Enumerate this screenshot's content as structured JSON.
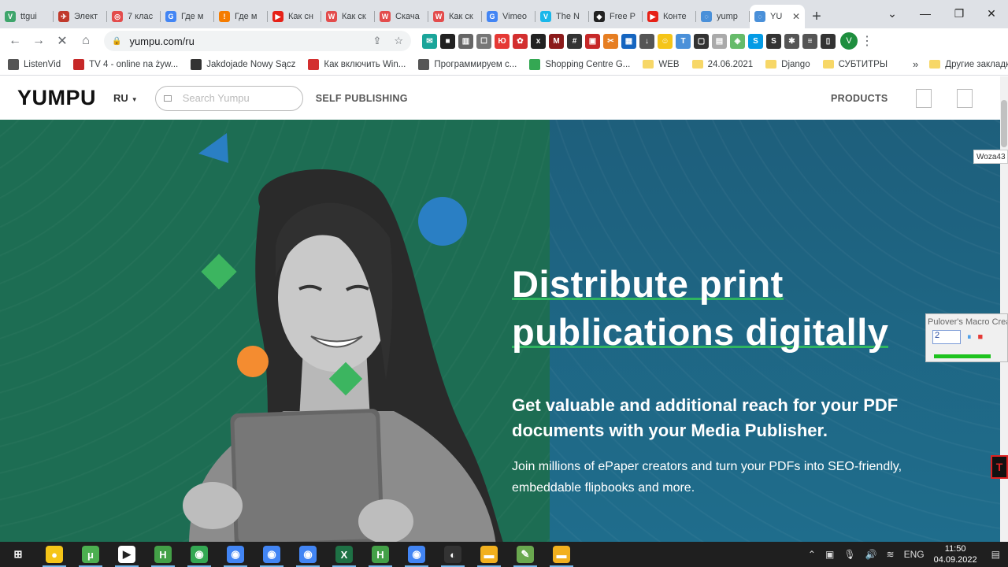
{
  "tabs": [
    {
      "title": "ttgui",
      "icon_color": "#3ea56b",
      "icon": "V"
    },
    {
      "title": "Элект",
      "icon_color": "#c0392b",
      "icon": "✈"
    },
    {
      "title": "7 клас",
      "icon_color": "#e34c4c",
      "icon": "◎"
    },
    {
      "title": "Где м",
      "icon_color": "#4285f4",
      "icon": "G"
    },
    {
      "title": "Где м",
      "icon_color": "#f57c00",
      "icon": "!"
    },
    {
      "title": "Как сн",
      "icon_color": "#e62117",
      "icon": "▶"
    },
    {
      "title": "Как ск",
      "icon_color": "#e34c4c",
      "icon": "W"
    },
    {
      "title": "Скача",
      "icon_color": "#e34c4c",
      "icon": "W"
    },
    {
      "title": "Как ск",
      "icon_color": "#e34c4c",
      "icon": "W"
    },
    {
      "title": "Vimeo",
      "icon_color": "#4285f4",
      "icon": "G"
    },
    {
      "title": "The N",
      "icon_color": "#1ab7ea",
      "icon": "V"
    },
    {
      "title": "Free P",
      "icon_color": "#222222",
      "icon": "◆"
    },
    {
      "title": "Конте",
      "icon_color": "#e62117",
      "icon": "▶"
    },
    {
      "title": "yump",
      "icon_color": "#4a90d9",
      "icon": "◌"
    },
    {
      "title": "YU",
      "icon_color": "#4a90d9",
      "icon": "◌",
      "active": true
    }
  ],
  "toolbar": {
    "url": "yumpu.com/ru",
    "profile_initial": "V"
  },
  "extensions": [
    {
      "color": "#1aa59a",
      "glyph": "✉"
    },
    {
      "color": "#222",
      "glyph": "■"
    },
    {
      "color": "#666",
      "glyph": "▥"
    },
    {
      "color": "#777",
      "glyph": "☐"
    },
    {
      "color": "#e53935",
      "glyph": "Ю"
    },
    {
      "color": "#d32f2f",
      "glyph": "✿"
    },
    {
      "color": "#222",
      "glyph": "x"
    },
    {
      "color": "#8b1a1a",
      "glyph": "M"
    },
    {
      "color": "#333",
      "glyph": "#"
    },
    {
      "color": "#c62828",
      "glyph": "▣"
    },
    {
      "color": "#e67e22",
      "glyph": "✂"
    },
    {
      "color": "#1565c0",
      "glyph": "▦"
    },
    {
      "color": "#555",
      "glyph": "↓"
    },
    {
      "color": "#f5c518",
      "glyph": "☺"
    },
    {
      "color": "#4a90d9",
      "glyph": "T"
    },
    {
      "color": "#333",
      "glyph": "▢"
    },
    {
      "color": "#aaa",
      "glyph": "▤"
    },
    {
      "color": "#66bb6a",
      "glyph": "◈"
    },
    {
      "color": "#039be5",
      "glyph": "S"
    },
    {
      "color": "#333",
      "glyph": "S"
    },
    {
      "color": "#555",
      "glyph": "✱"
    },
    {
      "color": "#555",
      "glyph": "≡"
    },
    {
      "color": "#333",
      "glyph": "▯"
    }
  ],
  "bookmarks": [
    {
      "label": "ListenVid",
      "type": "site",
      "color": "#555"
    },
    {
      "label": "TV 4 - online na żyw...",
      "type": "site",
      "color": "#c62828"
    },
    {
      "label": "Jakdojade Nowy Sącz",
      "type": "site",
      "color": "#333"
    },
    {
      "label": "Как включить Win...",
      "type": "site",
      "color": "#d32f2f"
    },
    {
      "label": "Программируем с...",
      "type": "site",
      "color": "#555"
    },
    {
      "label": "Shopping Centre G...",
      "type": "site",
      "color": "#34a853"
    },
    {
      "label": "WEB",
      "type": "folder"
    },
    {
      "label": "24.06.2021",
      "type": "folder"
    },
    {
      "label": "Django",
      "type": "folder"
    },
    {
      "label": "СУБТИТРЫ",
      "type": "folder"
    }
  ],
  "bookmarks_more": "»",
  "bookmarks_other": "Другие закладки",
  "site": {
    "logo": "YUMPU",
    "lang": "RU",
    "search_placeholder": "Search Yumpu",
    "self_publishing": "SELF PUBLISHING",
    "products": "PRODUCTS"
  },
  "hero": {
    "headline_line1": "Distribute print",
    "headline_line2": "publications digitally",
    "subheadline": "Get valuable and additional reach for your PDF documents with your Media Publisher.",
    "body": "Join millions of ePaper creators and turn your PDFs into SEO-friendly, embeddable flipbooks and more."
  },
  "overlays": {
    "woza_label": "Woza43",
    "macro_title": "Pulover's Macro Crea",
    "macro_value": "2"
  },
  "taskbar": {
    "items": [
      {
        "name": "start",
        "color": "#1f1f1f",
        "glyph": "⊞"
      },
      {
        "name": "app-yellow",
        "color": "#f5c518",
        "glyph": "●"
      },
      {
        "name": "utorrent",
        "color": "#4caf50",
        "glyph": "μ"
      },
      {
        "name": "media-player",
        "color": "#fff",
        "glyph": "▶"
      },
      {
        "name": "h-app",
        "color": "#43a047",
        "glyph": "H"
      },
      {
        "name": "chrome-1",
        "color": "#34a853",
        "glyph": "◉"
      },
      {
        "name": "chrome-2",
        "color": "#4285f4",
        "glyph": "◉"
      },
      {
        "name": "chrome-3",
        "color": "#4285f4",
        "glyph": "◉"
      },
      {
        "name": "chrome-4",
        "color": "#4285f4",
        "glyph": "◉"
      },
      {
        "name": "excel",
        "color": "#1e7145",
        "glyph": "X"
      },
      {
        "name": "h-app-2",
        "color": "#43a047",
        "glyph": "H"
      },
      {
        "name": "chrome-5",
        "color": "#4285f4",
        "glyph": "◉"
      },
      {
        "name": "obs",
        "color": "#333",
        "glyph": "◐"
      },
      {
        "name": "file-explorer",
        "color": "#f2b01e",
        "glyph": "▬"
      },
      {
        "name": "notepad",
        "color": "#6aa84f",
        "glyph": "✎"
      },
      {
        "name": "file-explorer-2",
        "color": "#f2b01e",
        "glyph": "▬"
      }
    ],
    "lang": "ENG",
    "time": "11:50",
    "date": "04.09.2022"
  }
}
